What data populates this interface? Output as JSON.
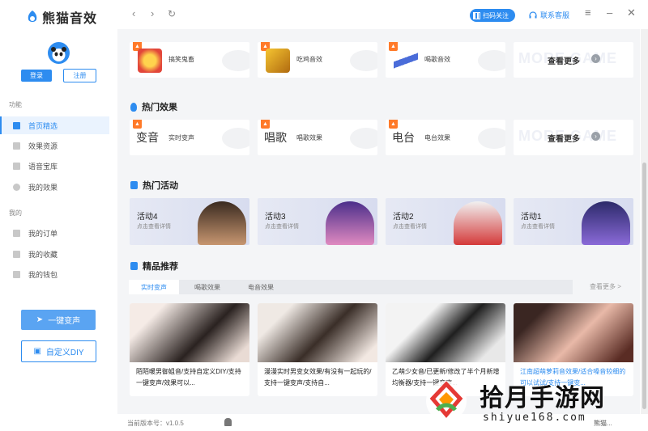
{
  "app": {
    "title": "熊猫音效"
  },
  "header": {
    "scan_follow": "扫码关注",
    "service": "联系客服"
  },
  "sidebar": {
    "login": "登录",
    "register": "注册",
    "section_function": "功能",
    "section_mine": "我的",
    "items": [
      {
        "label": "首页精选"
      },
      {
        "label": "效果资源"
      },
      {
        "label": "语音宝库"
      },
      {
        "label": "我的效果"
      },
      {
        "label": "我的订单"
      },
      {
        "label": "我的收藏"
      },
      {
        "label": "我的钱包"
      }
    ],
    "one_click_voice": "一键变声",
    "custom_diy": "自定义DIY"
  },
  "top_row": {
    "cards": [
      {
        "label": "搞笑鬼畜",
        "color": "#e2463a"
      },
      {
        "label": "吃鸡音效",
        "color": "#d49b15"
      },
      {
        "label": "喝歌音效",
        "color": "#4a6cd9"
      }
    ],
    "more": "查看更多",
    "more_bg": "MORE GAME"
  },
  "hot_effects": {
    "title": "热门效果",
    "cards": [
      {
        "big": "变音",
        "label": "实时变声"
      },
      {
        "big": "唱歌",
        "label": "唱歌效果"
      },
      {
        "big": "电台",
        "label": "电台效果"
      }
    ],
    "more": "查看更多",
    "more_bg": "MORE GAME"
  },
  "hot_activity": {
    "title": "热门活动",
    "items": [
      {
        "title": "活动4",
        "sub": "点击查看详情",
        "color": "#8a5a3a"
      },
      {
        "title": "活动3",
        "sub": "点击查看详情",
        "color": "#7b4fd0"
      },
      {
        "title": "活动2",
        "sub": "点击查看详情",
        "color": "#d43a3a"
      },
      {
        "title": "活动1",
        "sub": "点击查看详情",
        "color": "#5b3fa8"
      }
    ]
  },
  "featured": {
    "title": "精品推荐",
    "tabs": [
      "实时变声",
      "喝歌效果",
      "电音效果"
    ],
    "more": "查看更多 >",
    "items": [
      {
        "desc": "陌陌暖男御姐音/支持自定义DIY/支持一键变声/效果可以...",
        "highlight": false
      },
      {
        "desc": "漫漫实时男变女效果/有没有一起玩的/支持一键变声/支持自...",
        "highlight": false
      },
      {
        "desc": "乙萌少女音/已更新/修改了半个月新增均衡器/支持一键变声...",
        "highlight": false
      },
      {
        "desc": "江南超萌萝莉音效果/适合嗓音较细的可以试试/支持一键变...",
        "highlight": true
      }
    ]
  },
  "statusbar": {
    "version": "当前版本号：v1.0.5",
    "user": "熊猫..."
  },
  "watermark": {
    "text": "拾月手游网",
    "url": "shiyue168.com"
  }
}
